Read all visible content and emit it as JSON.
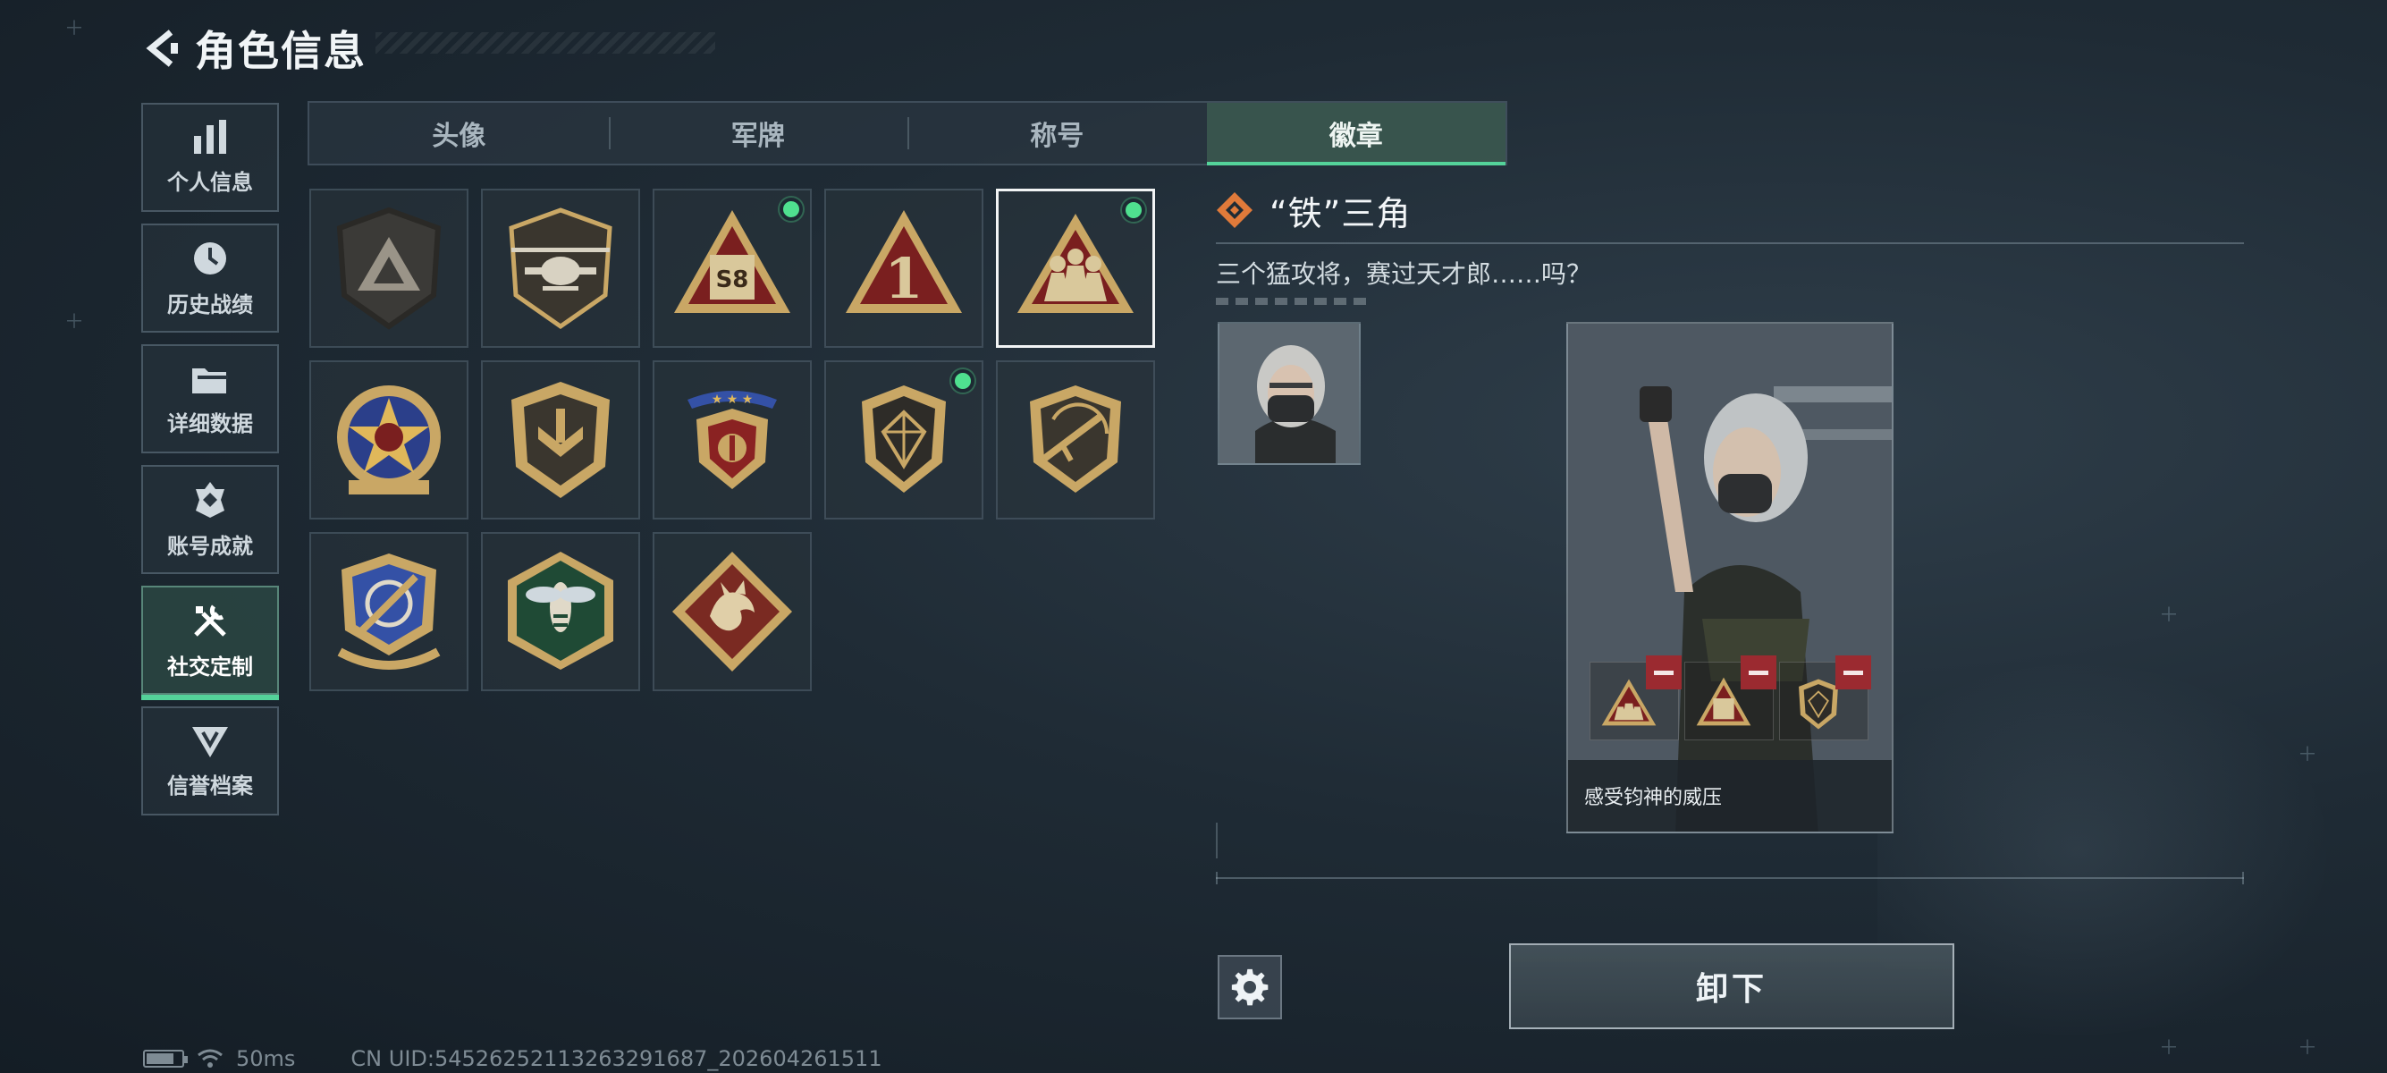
{
  "header": {
    "title": "角色信息",
    "back_icon": "back-arrow-icon"
  },
  "sidebar": {
    "items": [
      {
        "label": "个人信息",
        "icon": "bar-chart-icon",
        "active": false
      },
      {
        "label": "历史战绩",
        "icon": "clock-icon",
        "active": false
      },
      {
        "label": "详细数据",
        "icon": "folder-icon",
        "active": false
      },
      {
        "label": "账号成就",
        "icon": "achievement-icon",
        "active": false
      },
      {
        "label": "社交定制",
        "icon": "tools-icon",
        "active": true
      },
      {
        "label": "信誉档案",
        "icon": "reputation-icon",
        "active": false
      }
    ]
  },
  "tabs": [
    {
      "label": "头像",
      "active": false
    },
    {
      "label": "军牌",
      "active": false
    },
    {
      "label": "称号",
      "active": false
    },
    {
      "label": "徽章",
      "active": true
    }
  ],
  "badges": [
    {
      "icon": "triangle-shield-badge",
      "equipped": false,
      "selected": false
    },
    {
      "icon": "helicopter-badge",
      "equipped": false,
      "selected": false
    },
    {
      "icon": "s8-triangle-badge",
      "equipped": true,
      "selected": false
    },
    {
      "icon": "number-one-triangle-badge",
      "equipped": false,
      "selected": false
    },
    {
      "icon": "iron-triangle-badge",
      "equipped": true,
      "selected": true
    },
    {
      "icon": "star-roundel-badge",
      "equipped": false,
      "selected": false
    },
    {
      "icon": "chevron-shield-badge",
      "equipped": false,
      "selected": false
    },
    {
      "icon": "laurel-crest-badge",
      "equipped": false,
      "selected": false
    },
    {
      "icon": "gem-shield-badge",
      "equipped": true,
      "selected": false
    },
    {
      "icon": "rifle-shield-badge",
      "equipped": false,
      "selected": false
    },
    {
      "icon": "crosshair-crest-badge",
      "equipped": false,
      "selected": false
    },
    {
      "icon": "wasp-hexagon-badge",
      "equipped": false,
      "selected": false
    },
    {
      "icon": "dragon-diamond-badge",
      "equipped": false,
      "selected": false
    }
  ],
  "detail": {
    "name": "“铁”三角",
    "description": "三个猛攻将，赛过天才郎……吗？",
    "name_icon": "orange-diamond-icon"
  },
  "preview": {
    "caption": "感受钧神的威压",
    "slots": [
      {
        "icon": "iron-triangle-badge"
      },
      {
        "icon": "s8-triangle-badge"
      },
      {
        "icon": "gem-shield-badge"
      }
    ]
  },
  "actions": {
    "unequip_label": "卸下",
    "settings_icon": "gear-icon"
  },
  "status_bar": {
    "ping": "50ms",
    "uid": "CN UID:54526252113263291687_202604261511"
  },
  "colors": {
    "accent_green": "#54d39a",
    "equip_dot": "#4fe08f",
    "remove_red": "#9b2a30",
    "badge_gold": "#c9a765"
  }
}
